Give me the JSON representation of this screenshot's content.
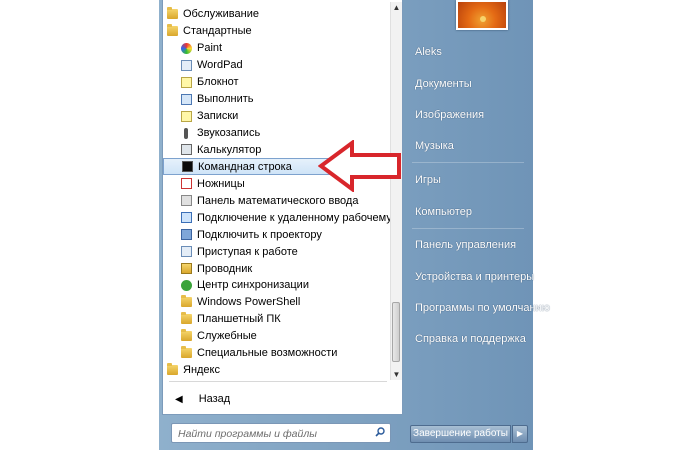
{
  "programs": [
    {
      "label": "Обслуживание",
      "icon": "folder-icon",
      "type": "folder"
    },
    {
      "label": "Стандартные",
      "icon": "folder-icon",
      "type": "folder"
    },
    {
      "label": "Paint",
      "icon": "paint-icon",
      "type": "app"
    },
    {
      "label": "WordPad",
      "icon": "wordpad-icon",
      "type": "app"
    },
    {
      "label": "Блокнот",
      "icon": "notepad-icon",
      "type": "app"
    },
    {
      "label": "Выполнить",
      "icon": "run-icon",
      "type": "app"
    },
    {
      "label": "Записки",
      "icon": "sticky-notes-icon",
      "type": "app"
    },
    {
      "label": "Звукозапись",
      "icon": "microphone-icon",
      "type": "app"
    },
    {
      "label": "Калькулятор",
      "icon": "calculator-icon",
      "type": "app"
    },
    {
      "label": "Командная строка",
      "icon": "command-prompt-icon",
      "type": "app",
      "highlight": true
    },
    {
      "label": "Ножницы",
      "icon": "snipping-tool-icon",
      "type": "app"
    },
    {
      "label": "Панель математического ввода",
      "icon": "math-input-icon",
      "type": "app"
    },
    {
      "label": "Подключение к удаленному рабочему столу",
      "icon": "remote-desktop-icon",
      "type": "app"
    },
    {
      "label": "Подключить к проектору",
      "icon": "projector-icon",
      "type": "app"
    },
    {
      "label": "Приступая к работе",
      "icon": "getting-started-icon",
      "type": "app"
    },
    {
      "label": "Проводник",
      "icon": "explorer-icon",
      "type": "app"
    },
    {
      "label": "Центр синхронизации",
      "icon": "sync-center-icon",
      "type": "app"
    },
    {
      "label": "Windows PowerShell",
      "icon": "folder-icon",
      "type": "app-folder"
    },
    {
      "label": "Планшетный ПК",
      "icon": "folder-icon",
      "type": "app-folder"
    },
    {
      "label": "Служебные",
      "icon": "folder-icon",
      "type": "app-folder"
    },
    {
      "label": "Специальные возможности",
      "icon": "folder-icon",
      "type": "app-folder"
    },
    {
      "label": "Яндекс",
      "icon": "folder-icon",
      "type": "folder"
    }
  ],
  "back_label": "Назад",
  "search": {
    "placeholder": "Найти программы и файлы"
  },
  "right_pane": {
    "user_name": "Aleks",
    "items": [
      "Документы",
      "Изображения",
      "Музыка",
      "Игры",
      "Компьютер",
      "Панель управления",
      "Устройства и принтеры",
      "Программы по умолчанию",
      "Справка и поддержка"
    ]
  },
  "shutdown_label": "Завершение работы",
  "colors": {
    "arrow": "#d8262b",
    "menu_blue": "#7a9cbf",
    "highlight": "#cfe4f7"
  }
}
